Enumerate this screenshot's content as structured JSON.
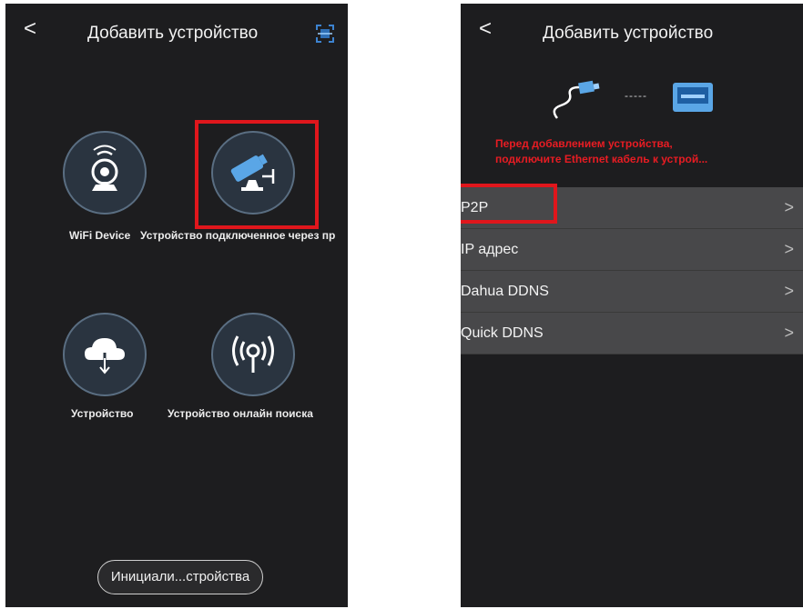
{
  "left_screen": {
    "header": {
      "back_glyph": "<",
      "title": "Добавить устройство",
      "corner_icon": "scan-icon"
    },
    "tiles": [
      {
        "icon": "wifi-camera-icon",
        "label": "WiFi Device"
      },
      {
        "icon": "wired-camera-icon",
        "label": "Устройство подключенное через пр"
      },
      {
        "icon": "cloud-download-icon",
        "label": "Устройство"
      },
      {
        "icon": "broadcast-icon",
        "label": "Устройство онлайн поиска"
      }
    ],
    "bottom_button": "Инициали...стройства"
  },
  "right_screen": {
    "header": {
      "back_glyph": "<",
      "title": "Добавить устройство"
    },
    "illustration": {
      "cable_icon": "ethernet-cable-icon",
      "connector": "-----",
      "device_icon": "nvr-device-icon"
    },
    "warning_lines": [
      "Перед добавлением устройства,",
      "подключите Ethernet кабель к устрой..."
    ],
    "options": [
      {
        "label": "P2P",
        "chevron": ">"
      },
      {
        "label": "IP адрес",
        "chevron": ">"
      },
      {
        "label": "Dahua DDNS",
        "chevron": ">"
      },
      {
        "label": "Quick DDNS",
        "chevron": ">"
      }
    ]
  },
  "colors": {
    "screen_bg": "#1d1d1f",
    "row_bg": "#48484a",
    "highlight": "#e0161c",
    "warning_text": "#e81c23",
    "icon_blue": "#5aa6e6",
    "circle_fill": "#2a3440"
  }
}
